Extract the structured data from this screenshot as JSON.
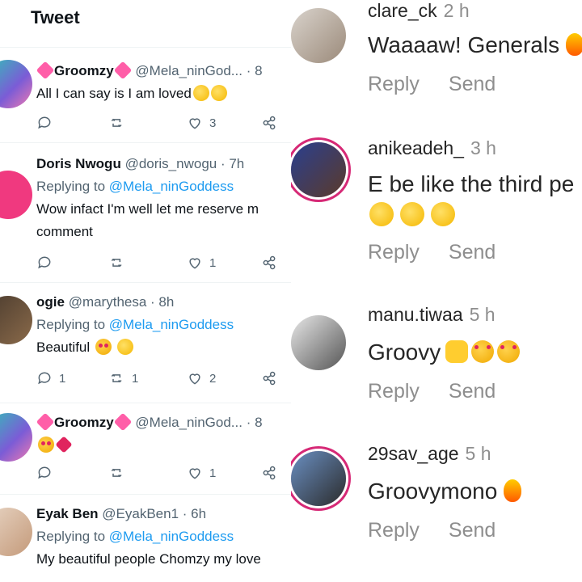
{
  "twitter": {
    "title": "Tweet",
    "tweets": [
      {
        "name": "Groomzy",
        "handle": "@Mela_ninGod...",
        "time": "· 8",
        "replying": "",
        "text": "All I can say is I am loved",
        "text2": "",
        "replies": "",
        "retweets": "",
        "likes": "3"
      },
      {
        "name": "Doris Nwogu",
        "handle": "@doris_nwogu",
        "time": "· 7h",
        "replying_prefix": "Replying to",
        "replying": "@Mela_ninGoddess",
        "text": "Wow infact I'm well let me reserve m",
        "text2": "comment",
        "replies": "",
        "retweets": "",
        "likes": "1"
      },
      {
        "name": "ogie",
        "handle": "@marythesa",
        "time": "· 8h",
        "replying_prefix": "Replying to",
        "replying": "@Mela_ninGoddess",
        "text": "Beautiful",
        "text2": "",
        "replies": "1",
        "retweets": "1",
        "likes": "2"
      },
      {
        "name": "Groomzy",
        "handle": "@Mela_ninGod...",
        "time": "· 8",
        "replying": "",
        "text": "",
        "text2": "",
        "replies": "",
        "retweets": "",
        "likes": "1"
      },
      {
        "name": "Eyak Ben",
        "handle": "@EyakBen1",
        "time": "· 6h",
        "replying_prefix": "Replying to",
        "replying": "@Mela_ninGoddess",
        "text": "My beautiful people Chomzy my love",
        "text2": ""
      }
    ]
  },
  "instagram": {
    "reply_label": "Reply",
    "send_label": "Send",
    "comments": [
      {
        "user": "clare_ck",
        "time": "2 h",
        "text": "Waaaaw! Generals"
      },
      {
        "user": "anikeadeh_",
        "time": "3 h",
        "text": "E be like the third pe"
      },
      {
        "user": "manu.tiwaa",
        "time": "5 h",
        "text": "Groovy"
      },
      {
        "user": "29sav_age",
        "time": "5 h",
        "text": "Groovymono"
      }
    ]
  },
  "colors": {
    "twitter_link": "#1d9bf0",
    "muted": "#536471",
    "ig_muted": "#8e8e8e",
    "story_ring": "#d62976"
  }
}
